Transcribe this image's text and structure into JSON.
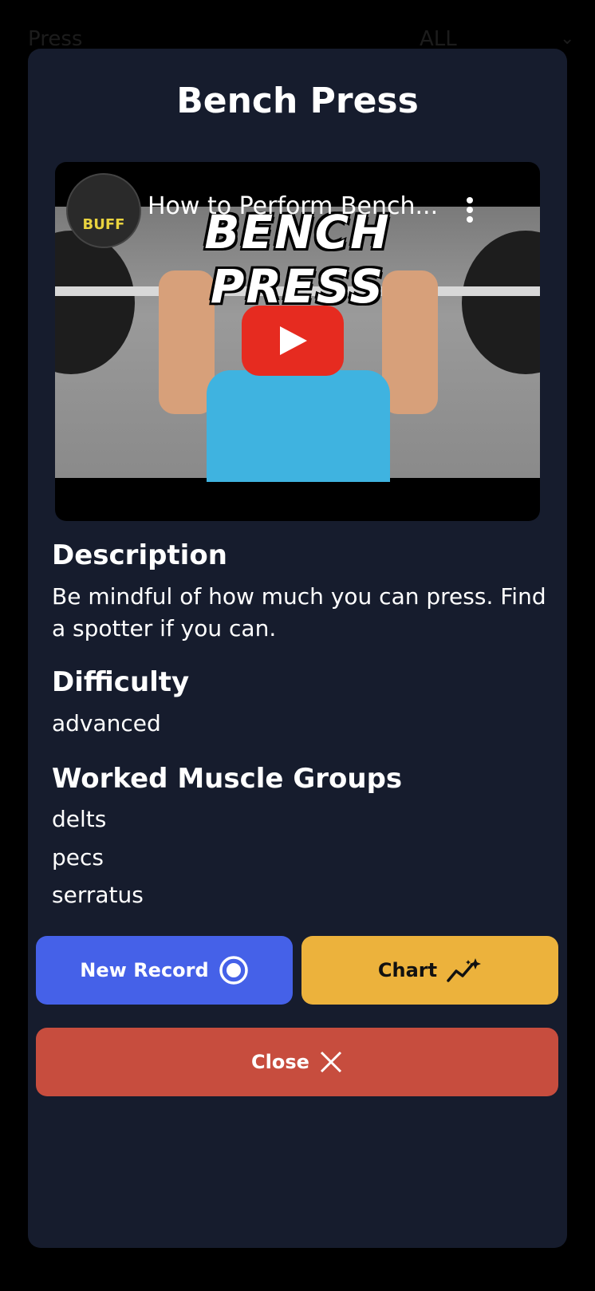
{
  "background": {
    "search_text": "Press",
    "filter_text": "ALL"
  },
  "modal": {
    "title": "Bench Press",
    "video": {
      "title": "How to Perform Bench...",
      "thumbnail_text_1": "BENCH",
      "thumbnail_text_2": "PRESS",
      "channel_logo_text": "BUFF"
    },
    "description": {
      "heading": "Description",
      "text": "Be mindful of how much you can press. Find a spotter if you can."
    },
    "difficulty": {
      "heading": "Difficulty",
      "value": "advanced"
    },
    "muscles": {
      "heading": "Worked Muscle Groups",
      "items": [
        "delts",
        "pecs",
        "serratus"
      ]
    },
    "buttons": {
      "new_record": "New Record",
      "chart": "Chart",
      "close": "Close"
    }
  },
  "colors": {
    "modal_bg": "#161c2d",
    "new_record": "#4561e8",
    "chart": "#ecb23c",
    "close": "#c74d3e",
    "play": "#e62b20"
  }
}
